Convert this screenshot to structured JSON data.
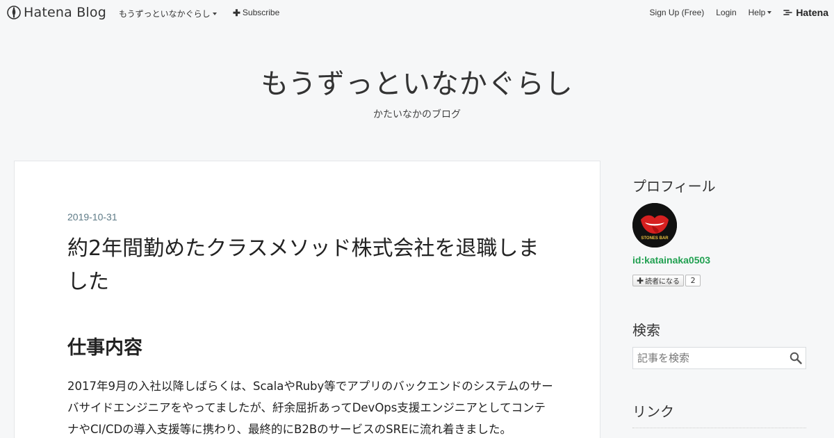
{
  "global_header": {
    "brand": "Hatena Blog",
    "blog_menu": "もうずっといなかぐらし",
    "subscribe": "Subscribe",
    "sign_up": "Sign Up (Free)",
    "login": "Login",
    "help": "Help",
    "hatena": "Hatena"
  },
  "blog": {
    "title": "もうずっといなかぐらし",
    "description": "かたいなかのブログ"
  },
  "entry": {
    "date": "2019-10-31",
    "title": "約2年間勤めたクラスメソッド株式会社を退職しました",
    "section_heading": "仕事内容",
    "body": "2017年9月の入社以降しばらくは、ScalaやRuby等でアプリのバックエンドのシステムのサーバサイドエンジニアをやってましたが、紆余屈折あってDevOps支援エンジニアとしてコンテナやCI/CDの導入支援等に携わり、最終的にB2BのサービスのSREに流れ着きました。"
  },
  "sidebar": {
    "profile_title": "プロフィール",
    "profile_id": "id:katainaka0503",
    "reader_button": "読者になる",
    "reader_count": "2",
    "avatar_text": "STONES BAR",
    "search_title": "検索",
    "search_placeholder": "記事を検索",
    "links_title": "リンク"
  },
  "colors": {
    "background": "#f6f7f8",
    "profile_id": "#20a050",
    "date": "#5d7a86",
    "avatar_lips": "#d62020"
  }
}
